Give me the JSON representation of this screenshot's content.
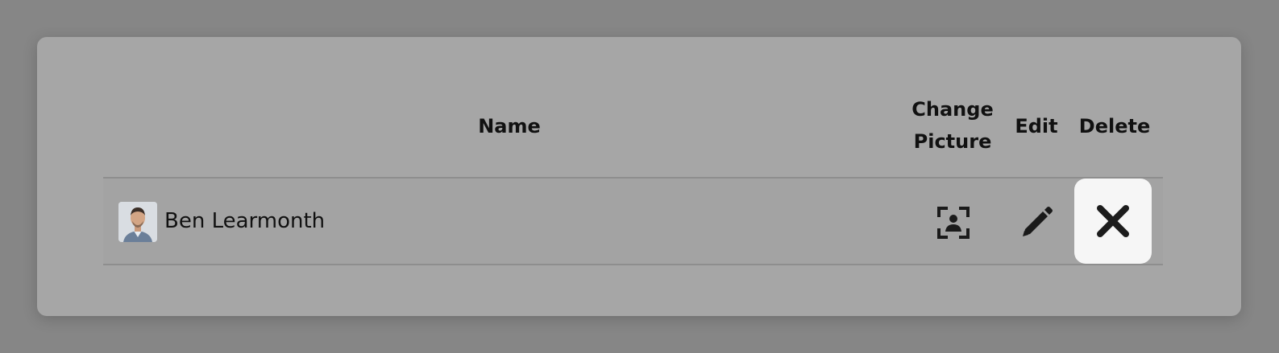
{
  "table": {
    "headers": {
      "name": "Name",
      "change_picture_line1": "Change",
      "change_picture_line2": "Picture",
      "edit": "Edit",
      "delete": "Delete"
    },
    "rows": [
      {
        "name": "Ben Learmonth"
      }
    ]
  },
  "icons": {
    "change_picture": "person-focus-icon",
    "edit": "pencil-icon",
    "delete": "close-icon"
  }
}
